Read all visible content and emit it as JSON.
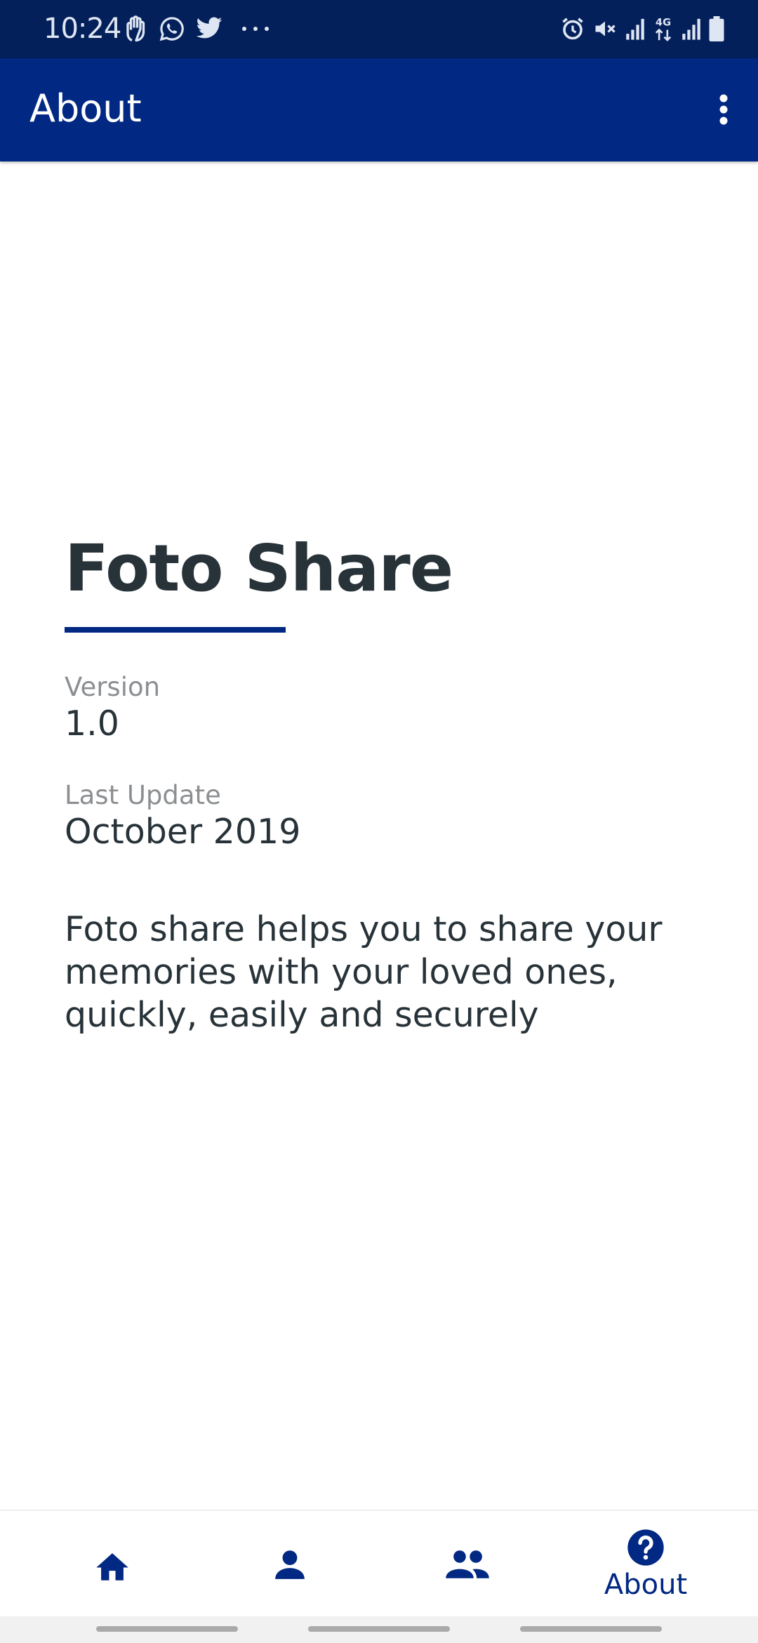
{
  "status_bar": {
    "time": "10:24",
    "left_icons": [
      "gesture-hand-icon",
      "whatsapp-icon",
      "twitter-icon",
      "more-notifications-icon"
    ],
    "right_icons": [
      "alarm-icon",
      "mute-icon",
      "signal-icon",
      "4g-data-icon",
      "signal-icon",
      "battery-icon"
    ],
    "network_label": "4G"
  },
  "app_bar": {
    "title": "About",
    "menu_icon": "more-vert-icon"
  },
  "about": {
    "app_name": "Foto Share",
    "version_label": "Version",
    "version_value": "1.0",
    "update_label": "Last Update",
    "update_value": "October 2019",
    "description": "Foto share helps you to share your memories with your loved ones, quickly, easily and securely"
  },
  "bottom_nav": {
    "items": [
      {
        "icon": "home-icon",
        "label": ""
      },
      {
        "icon": "person-icon",
        "label": ""
      },
      {
        "icon": "group-icon",
        "label": ""
      },
      {
        "icon": "help-icon",
        "label": "About",
        "selected": true
      }
    ]
  },
  "colors": {
    "status_bar": "#03205a",
    "primary": "#012883",
    "text_dark": "#283339",
    "text_muted": "#8c8f92"
  }
}
